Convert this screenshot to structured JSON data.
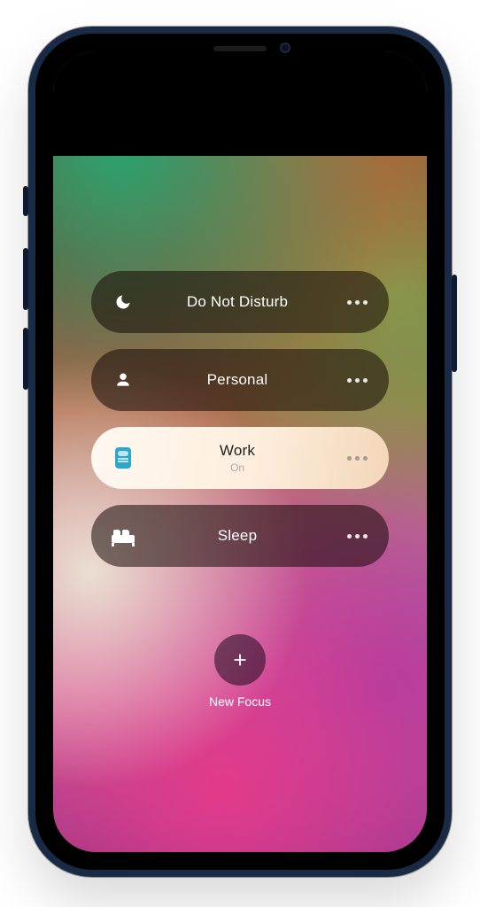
{
  "focus": {
    "modes": [
      {
        "id": "dnd",
        "label": "Do Not Disturb",
        "status": "",
        "active": false,
        "icon": "moon-icon"
      },
      {
        "id": "personal",
        "label": "Personal",
        "status": "",
        "active": false,
        "icon": "person-icon"
      },
      {
        "id": "work",
        "label": "Work",
        "status": "On",
        "active": true,
        "icon": "badge-icon"
      },
      {
        "id": "sleep",
        "label": "Sleep",
        "status": "",
        "active": false,
        "icon": "bed-icon"
      }
    ],
    "new_label": "New Focus"
  }
}
